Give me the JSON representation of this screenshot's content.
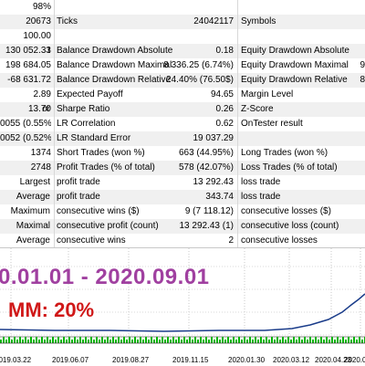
{
  "rows": [
    {
      "a": "",
      "b": "98%",
      "c": "",
      "d": "",
      "e": "",
      "f": ""
    },
    {
      "a": "",
      "b": "20673",
      "c": "Ticks",
      "d": "24042117",
      "e": "Symbols",
      "f": ""
    },
    {
      "a": "",
      "b": "100.00",
      "c": "",
      "d": "",
      "e": "",
      "f": ""
    },
    {
      "a": "t",
      "b": "130 052.33",
      "c": "Balance Drawdown Absolute",
      "d": "0.18",
      "e": "Equity Drawdown Absolute",
      "f": ""
    },
    {
      "a": "",
      "b": "198 684.05",
      "c": "Balance Drawdown Maximal",
      "d": "8 336.25 (6.74%)",
      "e": "Equity Drawdown Maximal",
      "f": "9"
    },
    {
      "a": "",
      "b": "-68 631.72",
      "c": "Balance Drawdown Relative",
      "d": "24.40% (76.50$)",
      "e": "Equity Drawdown Relative",
      "f": "8"
    },
    {
      "a": "",
      "b": "2.89",
      "c": "Expected Payoff",
      "d": "94.65",
      "e": "Margin Level",
      "f": ""
    },
    {
      "a": "or",
      "b": "13.70",
      "c": "Sharpe Ratio",
      "d": "0.26",
      "e": "Z-Score",
      "f": ""
    },
    {
      "a": "",
      "b": "0055 (0.55%)",
      "c": "LR Correlation",
      "d": "0.62",
      "e": "OnTester result",
      "f": ""
    },
    {
      "a": "",
      "b": "0052 (0.52%)",
      "c": "LR Standard Error",
      "d": "19 037.29",
      "e": "",
      "f": ""
    },
    {
      "a": "",
      "b": "1374",
      "c": "Short Trades (won %)",
      "d": "663 (44.95%)",
      "e": "Long Trades (won %)",
      "f": ""
    },
    {
      "a": "",
      "b": "2748",
      "c": "Profit Trades (% of total)",
      "d": "578 (42.07%)",
      "e": "Loss Trades (% of total)",
      "f": ""
    },
    {
      "a": "Largest",
      "b": "",
      "c": "profit trade",
      "d": "13 292.43",
      "e": "loss trade",
      "f": ""
    },
    {
      "a": "Average",
      "b": "",
      "c": "profit trade",
      "d": "343.74",
      "e": "loss trade",
      "f": ""
    },
    {
      "a": "Maximum",
      "b": "",
      "c": "consecutive wins ($)",
      "d": "9 (7 118.12)",
      "e": "consecutive losses ($)",
      "f": ""
    },
    {
      "a": "Maximal",
      "b": "",
      "c": "consecutive profit (count)",
      "d": "13 292.43 (1)",
      "e": "consecutive loss (count)",
      "f": ""
    },
    {
      "a": "Average",
      "b": "",
      "c": "consecutive wins",
      "d": "2",
      "e": "consecutive losses",
      "f": ""
    }
  ],
  "overlay": {
    "period": "0.01.01 - 2020.09.01",
    "mm": "MM: 20%"
  },
  "x_ticks": [
    "2019.03.22",
    "2019.06.07",
    "2019.08.27",
    "2019.11.15",
    "2020.01.30",
    "2020.03.12",
    "2020.04.23",
    "2020.06.1"
  ],
  "colors": {
    "balance_line": "#1a3c8a",
    "volume_bars": "#00b400",
    "period_text": "#a040a0",
    "mm_text": "#d01818"
  }
}
